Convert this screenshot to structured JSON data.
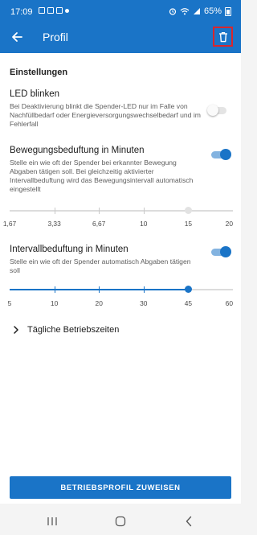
{
  "status_bar": {
    "time": "17:09",
    "battery": "65%",
    "icons": [
      "photo-icon",
      "gallery-icon",
      "mail-icon",
      "dot-icon",
      "alarm-icon",
      "wifi-icon",
      "signal-icon",
      "battery-icon"
    ]
  },
  "app_bar": {
    "title": "Profil",
    "back_icon": "arrow-left-icon",
    "delete_icon": "trash-icon"
  },
  "settings": {
    "heading": "Einstellungen",
    "led": {
      "title": "LED blinken",
      "description": "Bei Deaktivierung blinkt die Spender-LED nur im Falle von Nachfüllbedarf oder Energieversorgungswechselbedarf und im Fehlerfall",
      "enabled": false
    },
    "movement": {
      "title": "Bewegungsbeduftung in Minuten",
      "description": "Stelle ein wie oft der Spender bei erkannter Bewegung Abgaben tätigen soll. Bei gleichzeitig aktivierter Intervallbeduftung wird das Bewegungsintervall automatisch eingestellt",
      "enabled": true,
      "slider_enabled": false,
      "ticks": [
        "1,67",
        "3,33",
        "6,67",
        "10",
        "15",
        "20"
      ],
      "value": "15"
    },
    "interval": {
      "title": "Intervallbeduftung in Minuten",
      "description": "Stelle ein wie oft der Spender automatisch Abgaben tätigen soll",
      "enabled": true,
      "slider_enabled": true,
      "ticks": [
        "5",
        "10",
        "20",
        "30",
        "45",
        "60"
      ],
      "value": "45"
    },
    "operating_hours": {
      "label": "Tägliche Betriebszeiten",
      "icon": "chevron-right-icon"
    }
  },
  "primary_action": "BETRIEBSPROFIL ZUWEISEN",
  "nav_bar": {
    "items": [
      "recent-apps-icon",
      "home-icon",
      "back-icon"
    ]
  },
  "colors": {
    "primary": "#1a74c7",
    "highlight": "#d8262c",
    "toggle_track_on": "#83b3e0"
  }
}
